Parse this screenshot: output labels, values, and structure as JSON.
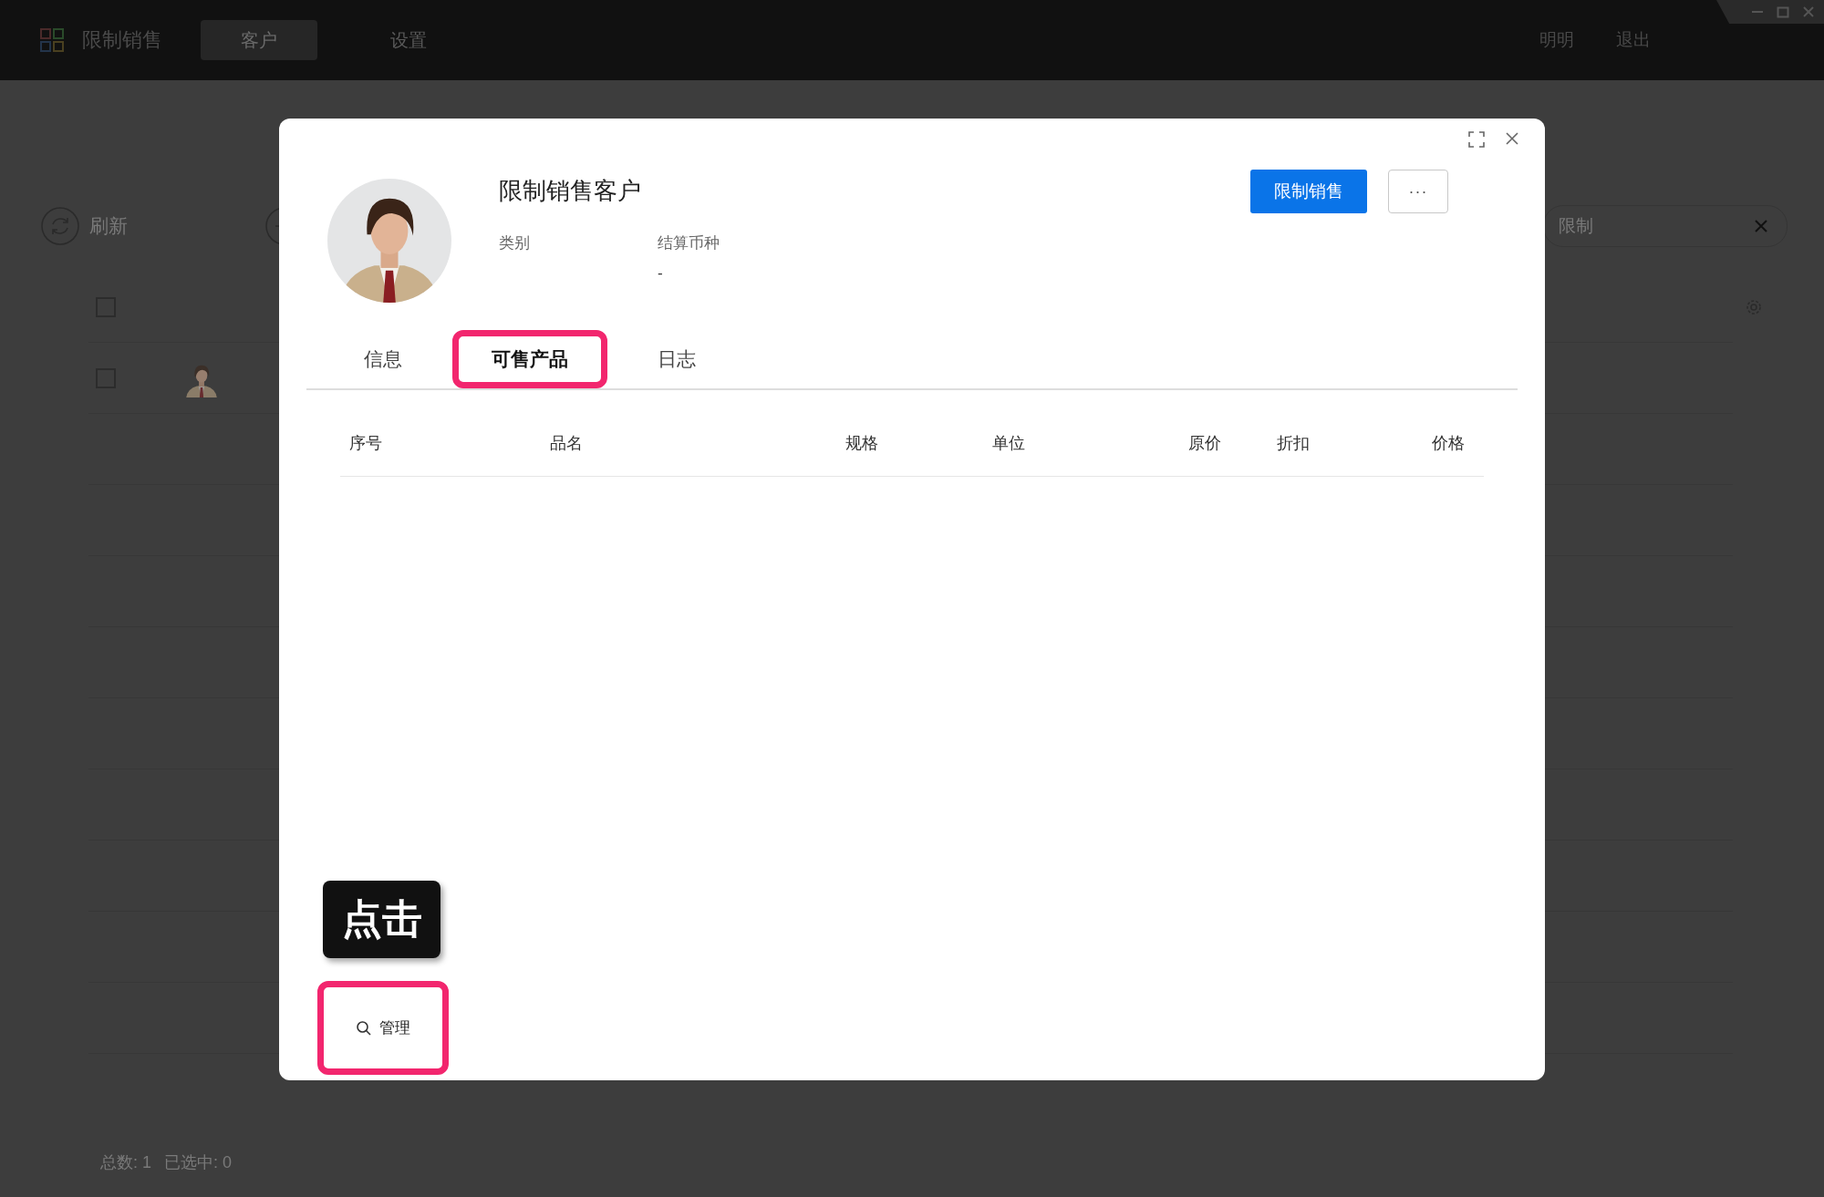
{
  "app_bar": {
    "title": "限制销售",
    "nav": [
      {
        "label": "客户",
        "selected": true
      },
      {
        "label": "设置",
        "selected": false
      }
    ],
    "user": "明明",
    "logout": "退出"
  },
  "toolbar": {
    "refresh": "刷新",
    "search": {
      "value": "限制"
    }
  },
  "list": {
    "rows": [
      {
        "checked": false
      }
    ],
    "header_checked": false
  },
  "footer": {
    "total_label": "总数:",
    "total": "1",
    "selected_label": "已选中:",
    "selected": "0"
  },
  "modal": {
    "name": "限制销售客户",
    "fields": [
      {
        "label": "类别"
      },
      {
        "label": "结算币种",
        "value": "-"
      }
    ],
    "primary_button": "限制销售",
    "more_button": "···",
    "tabs": [
      {
        "label": "信息",
        "selected": false,
        "highlighted": false
      },
      {
        "label": "可售产品",
        "selected": true,
        "highlighted": true
      },
      {
        "label": "日志",
        "selected": false,
        "highlighted": false
      }
    ],
    "columns": [
      "序号",
      "品名",
      "规格",
      "单位",
      "原价",
      "折扣",
      "价格"
    ],
    "tooltip": "点击",
    "manage_button": {
      "label": "管理",
      "highlighted": true
    }
  }
}
